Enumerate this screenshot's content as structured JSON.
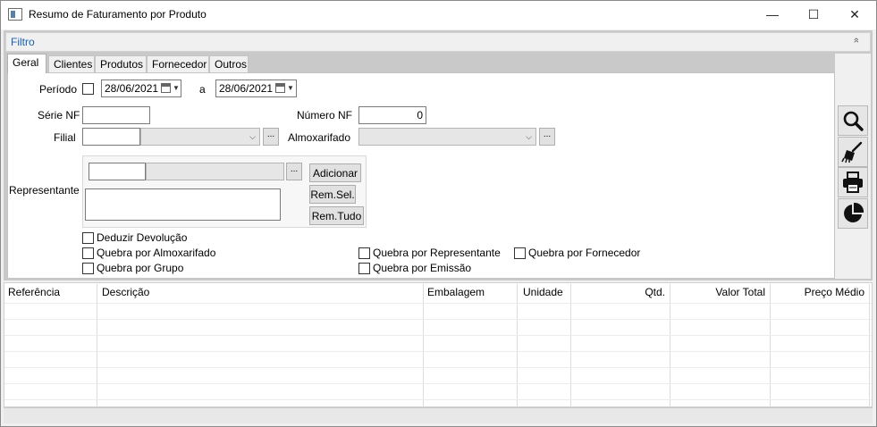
{
  "window": {
    "title": "Resumo de Faturamento por Produto",
    "minimize_glyph": "—",
    "maximize_glyph": "☐",
    "close_glyph": "✕"
  },
  "filter": {
    "title": "Filtro",
    "collapse_glyph": "»",
    "tabs": [
      "Geral",
      "Clientes",
      "Produtos",
      "Fornecedor",
      "Outros"
    ],
    "periodo": {
      "label": "Período",
      "checked": false,
      "from": "28/06/2021",
      "separator": "a",
      "to": "28/06/2021"
    },
    "serie_nf": {
      "label": "Série NF",
      "value": ""
    },
    "numero_nf": {
      "label": "Número NF",
      "value": "0"
    },
    "filial": {
      "label": "Filial",
      "code": "",
      "name": "",
      "dots": "..."
    },
    "almoxarifado": {
      "label": "Almoxarifado",
      "value": "",
      "dots": "..."
    },
    "representante": {
      "label": "Representante",
      "code": "",
      "name": "",
      "dots": "...",
      "add_label": "Adicionar",
      "remove_sel_label": "Rem.Sel.",
      "remove_all_label": "Rem.Tudo"
    },
    "checkboxes": {
      "deduzir_devolucao": "Deduzir Devolução",
      "quebra_almoxarifado": "Quebra por Almoxarifado",
      "quebra_grupo": "Quebra por Grupo",
      "quebra_representante": "Quebra por Representante",
      "quebra_emissao": "Quebra por Emissão",
      "quebra_fornecedor": "Quebra por Fornecedor"
    }
  },
  "toolbar": {
    "icons": [
      "search-icon",
      "clear-broom-icon",
      "print-icon",
      "pie-chart-icon"
    ]
  },
  "grid": {
    "columns": [
      "Referência",
      "Descrição",
      "Embalagem",
      "Unidade",
      "Qtd.",
      "Valor Total",
      "Preço Médio"
    ],
    "rows": []
  }
}
